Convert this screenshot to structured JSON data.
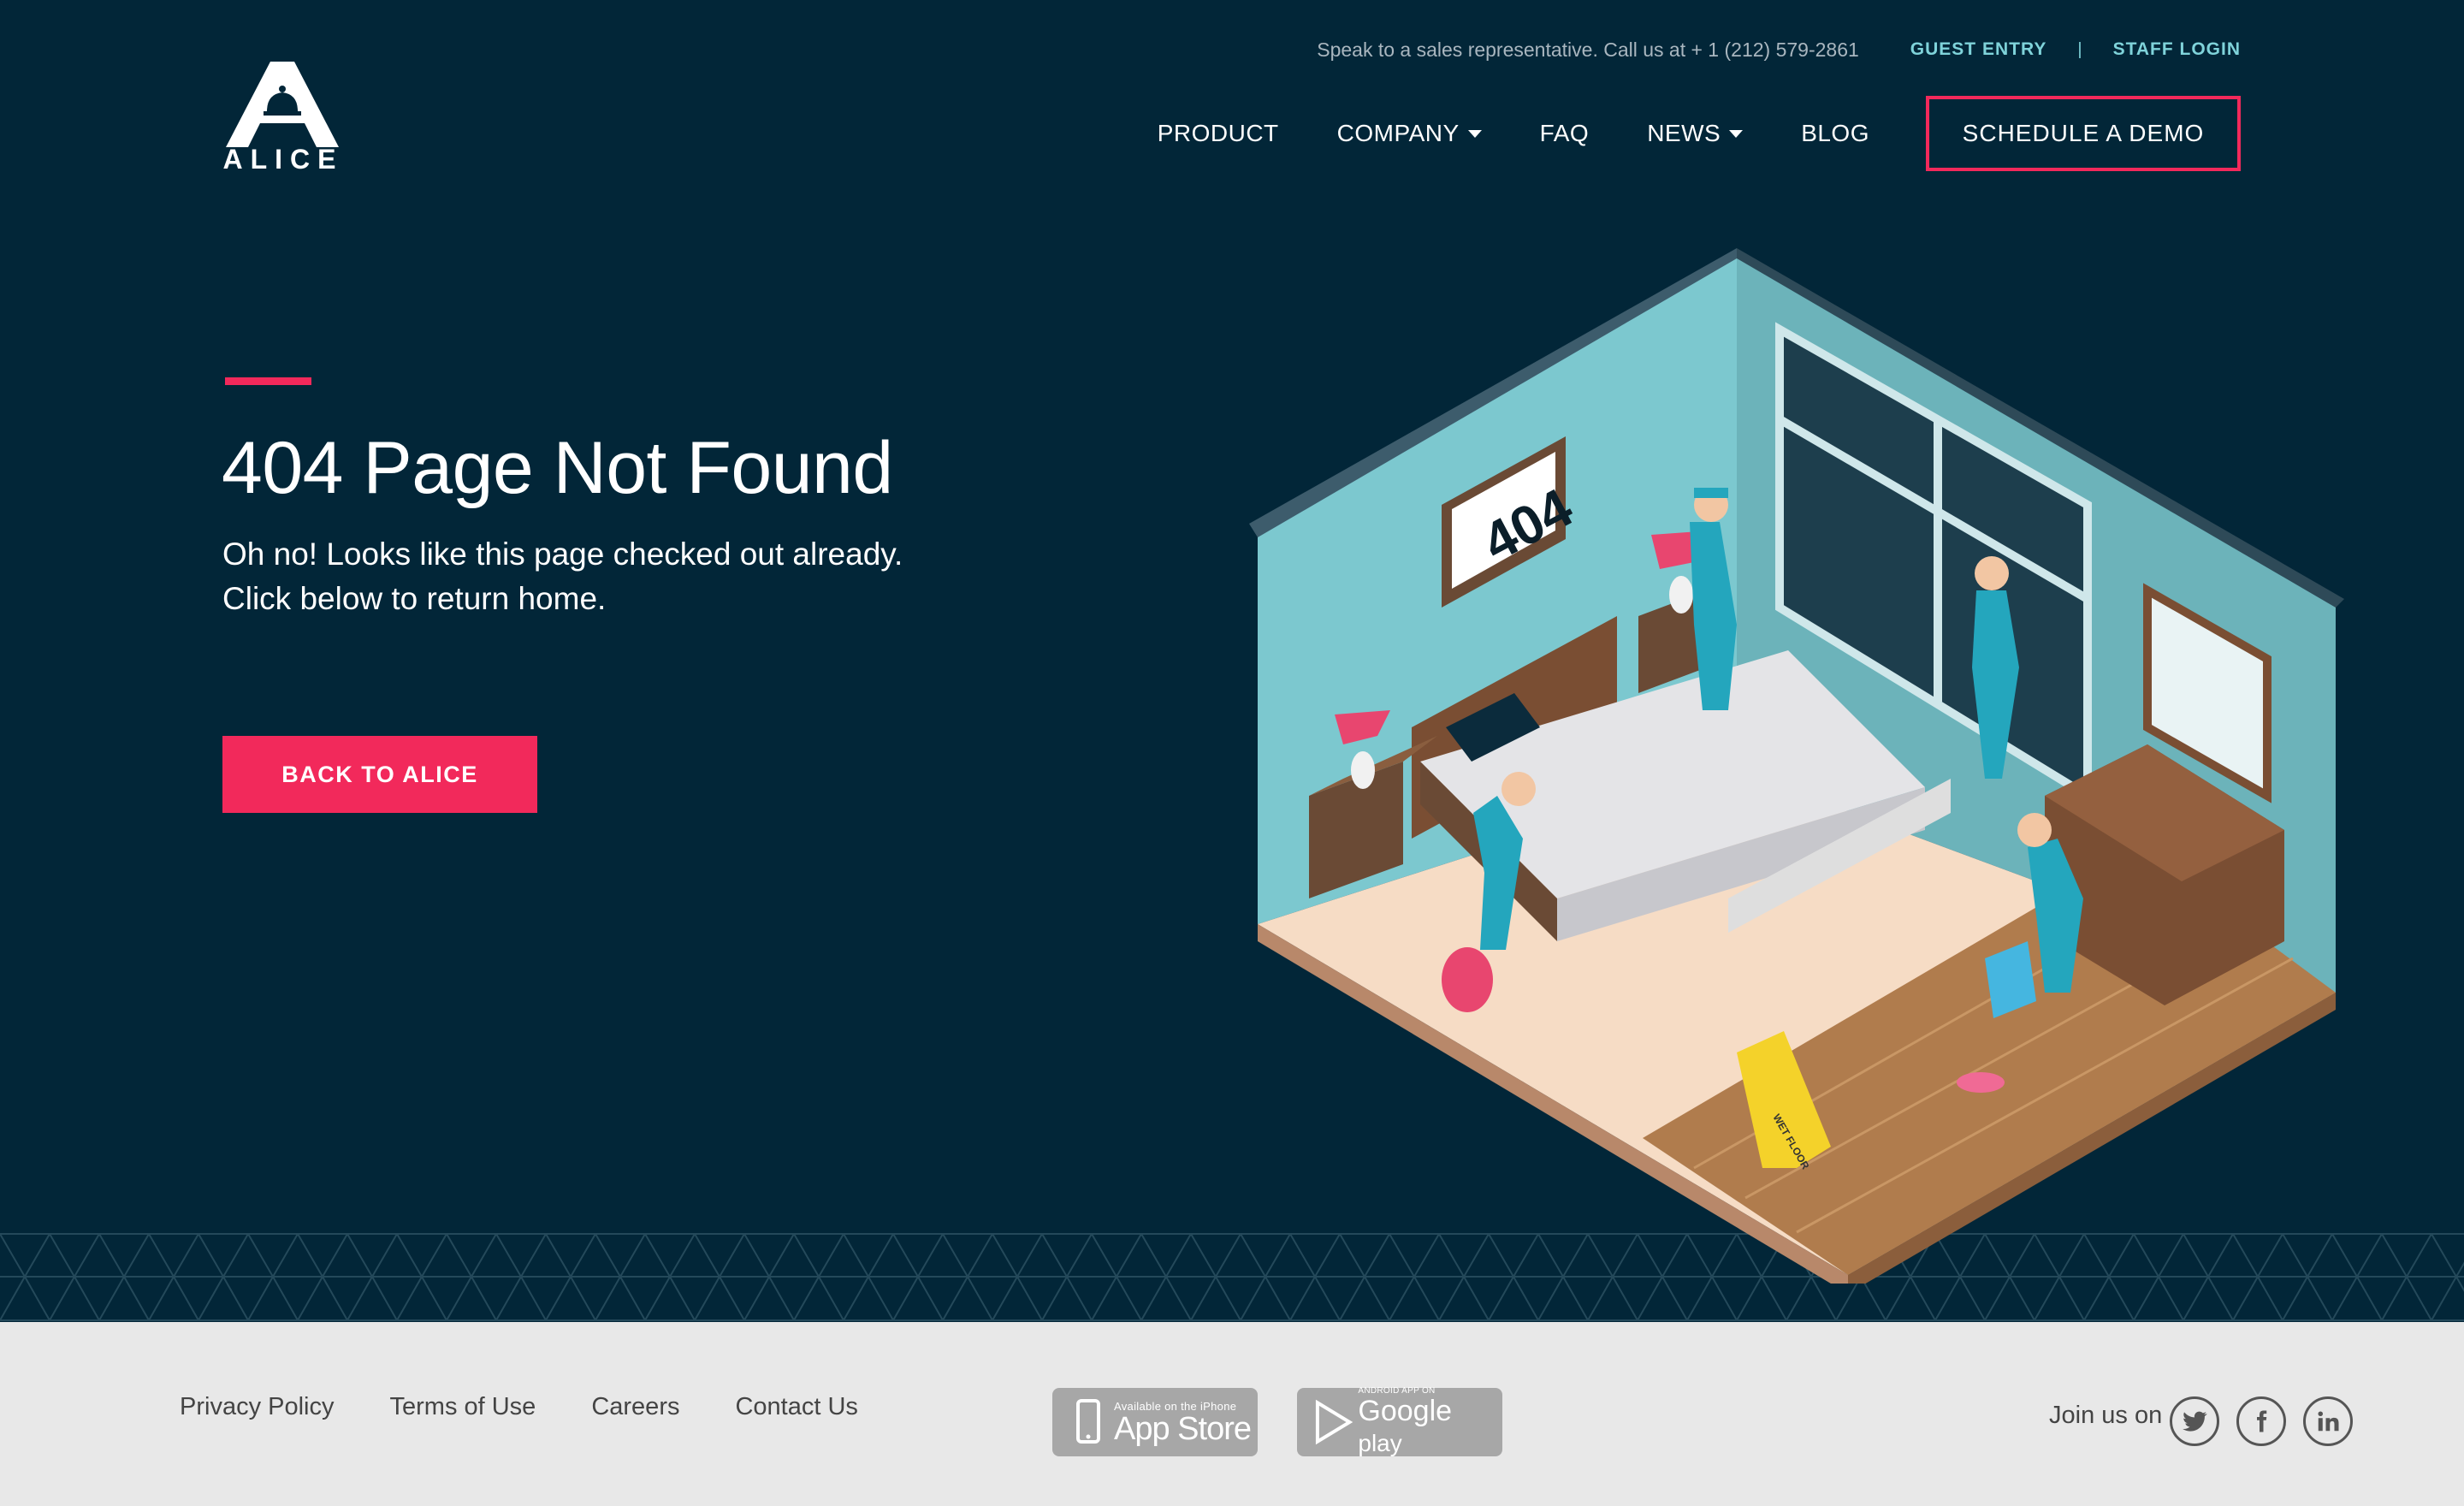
{
  "topbar": {
    "sales_text": "Speak to a sales representative. Call us at + 1 (212) 579-2861",
    "guest_entry": "GUEST ENTRY",
    "separator": "|",
    "staff_login": "STAFF LOGIN"
  },
  "logo": {
    "text": "ALICE",
    "icon": "bell-a-logo-icon"
  },
  "nav": {
    "items": [
      {
        "label": "PRODUCT",
        "dropdown": false
      },
      {
        "label": "COMPANY",
        "dropdown": true
      },
      {
        "label": "FAQ",
        "dropdown": false
      },
      {
        "label": "NEWS",
        "dropdown": true
      },
      {
        "label": "BLOG",
        "dropdown": false
      }
    ],
    "cta": "SCHEDULE A DEMO"
  },
  "main": {
    "title": "404 Page Not Found",
    "subtitle_line1": "Oh no! Looks like this page checked out already.",
    "subtitle_line2": "Click below to return home.",
    "button": "BACK TO ALICE"
  },
  "illustration": {
    "sign_text": "404",
    "wet_floor_text": "WET FLOOR"
  },
  "footer": {
    "links": [
      "Privacy Policy",
      "Terms of Use",
      "Careers",
      "Contact Us"
    ],
    "apple": {
      "small": "Available on the iPhone",
      "big": "App Store"
    },
    "google": {
      "small": "ANDROID APP ON",
      "big": "Google",
      "suffix": "play"
    },
    "join_text": "Join us on",
    "social": [
      "twitter-icon",
      "facebook-icon",
      "linkedin-icon"
    ]
  },
  "colors": {
    "background": "#022638",
    "accent": "#f2295b",
    "teal": "#7fd3da",
    "footer": "#e8e8e8"
  }
}
